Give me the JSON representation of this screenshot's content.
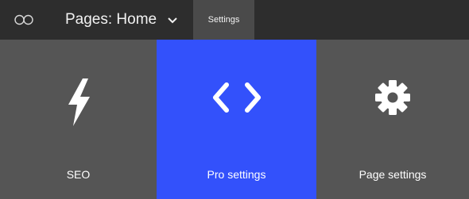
{
  "topbar": {
    "logo_icon": "infinity-icon",
    "page_select_label": "Pages: Home",
    "page_select_icon": "chevron-down-icon",
    "settings_tab_label": "Settings"
  },
  "panels": [
    {
      "label": "SEO",
      "icon": "lightning-icon",
      "active": false
    },
    {
      "label": "Pro settings",
      "icon": "code-brackets-icon",
      "active": true
    },
    {
      "label": "Page settings",
      "icon": "gear-icon",
      "active": false
    }
  ],
  "colors": {
    "topbar_bg": "#2d2d2d",
    "settings_tab_bg": "#4a4a4a",
    "panel_bg": "#555555",
    "active_panel_bg": "#3351fb",
    "text": "#ffffff"
  }
}
